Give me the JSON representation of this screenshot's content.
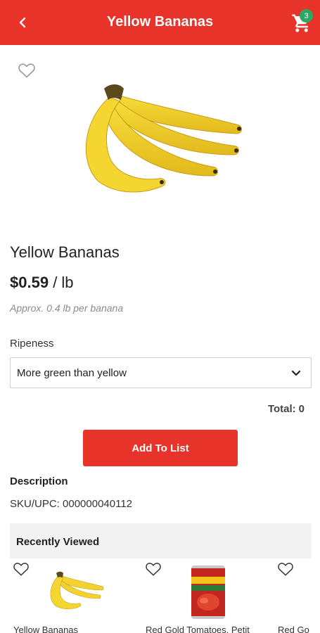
{
  "header": {
    "title": "Yellow Bananas",
    "cart_count": "3"
  },
  "product": {
    "name": "Yellow Bananas",
    "price": "$0.59",
    "unit": "/ lb",
    "approx": "Approx. 0.4 lb per banana"
  },
  "ripeness": {
    "label": "Ripeness",
    "selected": "More green than yellow"
  },
  "total": {
    "label": "Total:",
    "value": "0"
  },
  "actions": {
    "add_to_list": "Add To List"
  },
  "description": {
    "heading": "Description",
    "sku": "SKU/UPC: 000000040112"
  },
  "recently_viewed": {
    "title": "Recently Viewed",
    "items": [
      {
        "name": "Yellow Bananas"
      },
      {
        "name": "Red Gold Tomatoes, Petit"
      },
      {
        "name": "Red Go"
      }
    ]
  },
  "colors": {
    "brand_red": "#e8332a",
    "badge_green": "#2ba866"
  },
  "icons": [
    "back-arrow-icon",
    "cart-icon",
    "heart-outline-icon",
    "chevron-down-icon"
  ]
}
